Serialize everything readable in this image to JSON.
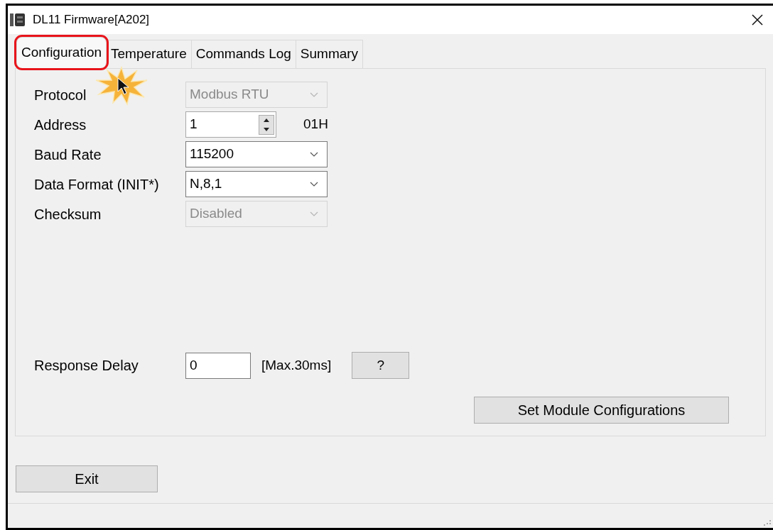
{
  "window": {
    "title": "DL11 Firmware[A202]"
  },
  "tabs": [
    {
      "label": "Configuration",
      "selected": true,
      "highlighted": true
    },
    {
      "label": "Temperature",
      "selected": false,
      "highlighted": false
    },
    {
      "label": "Commands Log",
      "selected": false,
      "highlighted": false
    },
    {
      "label": "Summary",
      "selected": false,
      "highlighted": false
    }
  ],
  "settings": [
    {
      "label": "Protocol",
      "kind": "combo",
      "value": "Modbus RTU",
      "disabled": true
    },
    {
      "label": "Address",
      "kind": "spin",
      "value": "1",
      "disabled": false,
      "hex": "01H"
    },
    {
      "label": "Baud Rate",
      "kind": "combo",
      "value": "115200",
      "disabled": false
    },
    {
      "label": "Data Format (INIT*)",
      "kind": "combo",
      "value": "N,8,1",
      "disabled": false
    },
    {
      "label": "Checksum",
      "kind": "combo",
      "value": "Disabled",
      "disabled": true
    }
  ],
  "response_delay": {
    "label": "Response Delay",
    "value": "0",
    "hint": "[Max.30ms]",
    "help_button": "?"
  },
  "set_button": "Set Module Configurations",
  "exit_button": "Exit"
}
